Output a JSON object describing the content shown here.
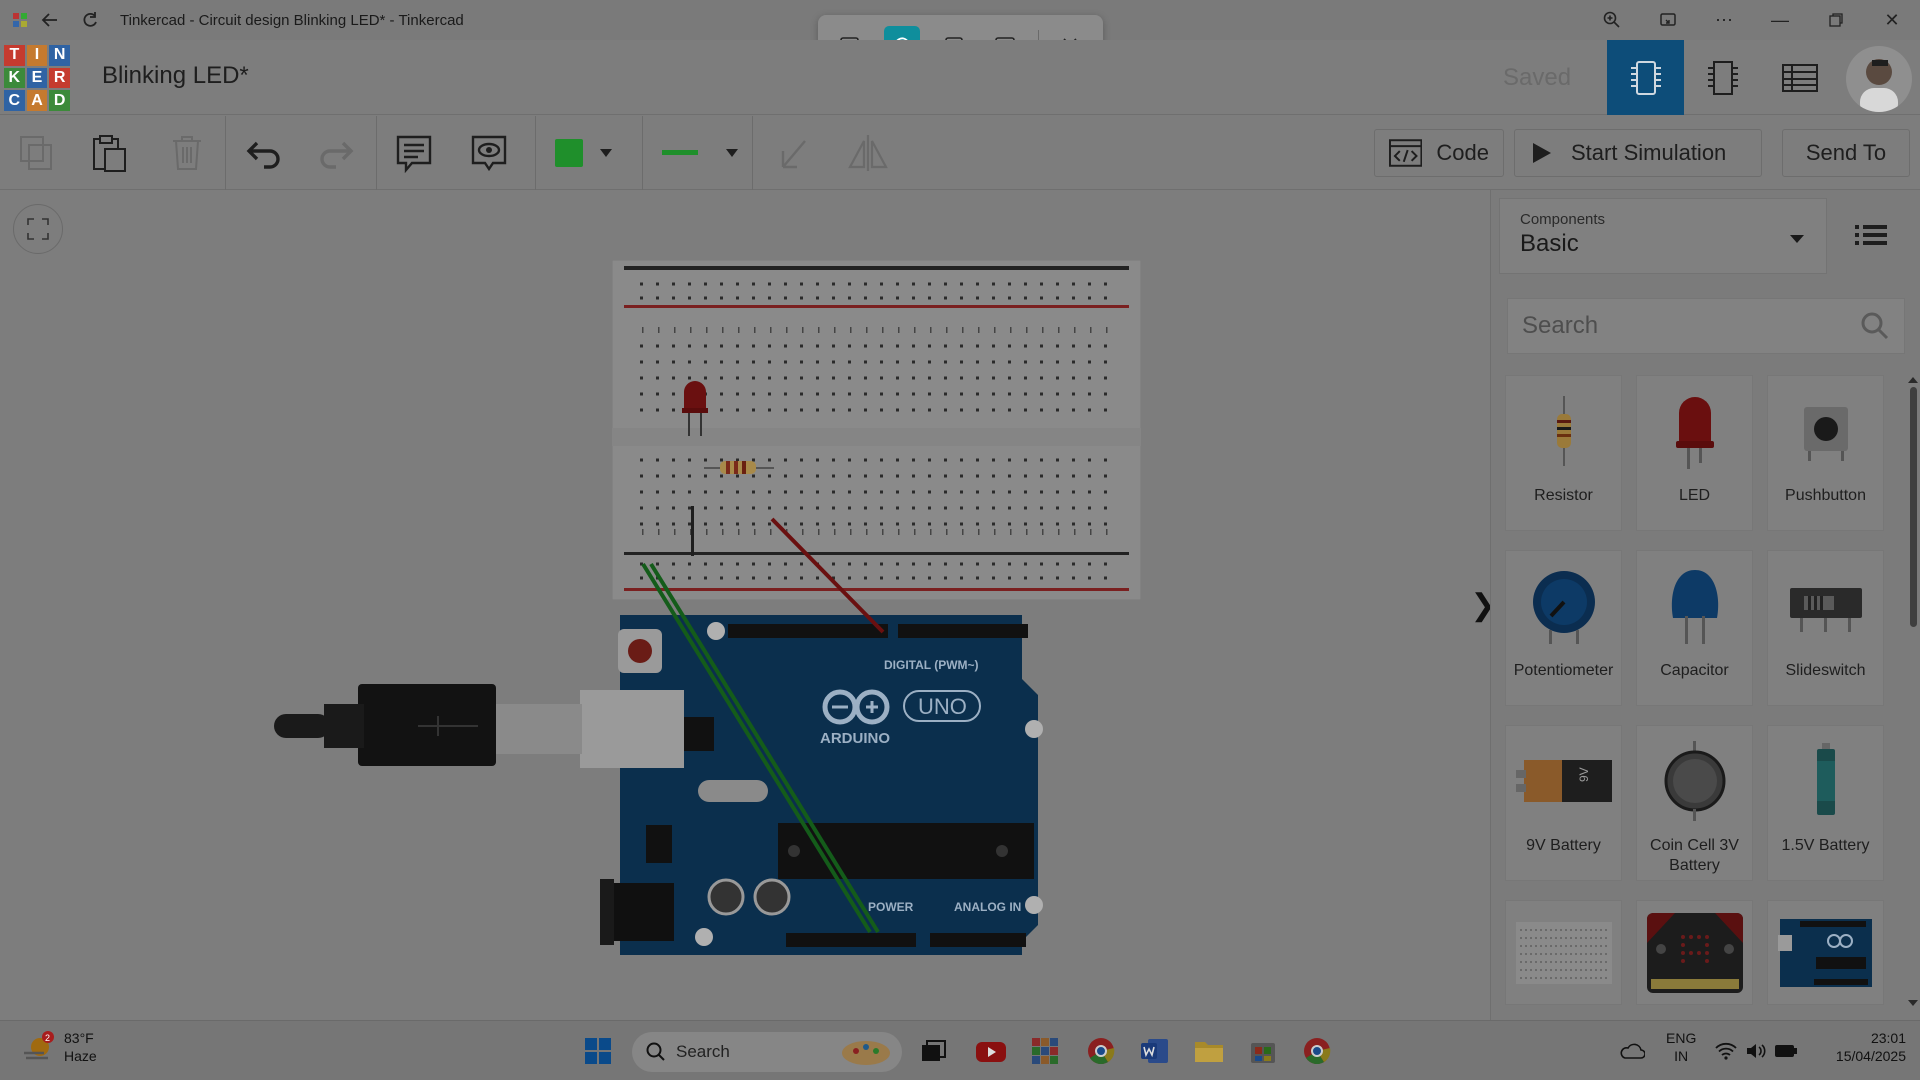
{
  "window": {
    "title": "Tinkercad - Circuit design Blinking LED* - Tinkercad"
  },
  "app": {
    "logo_letters": [
      "T",
      "I",
      "N",
      "K",
      "E",
      "R",
      "C",
      "A",
      "D"
    ],
    "project_title": "Blinking LED*",
    "saved_status": "Saved"
  },
  "toolbar": {
    "code_label": "Code",
    "start_sim_label": "Start Simulation",
    "send_to_label": "Send To",
    "wire_color": "#1f8f2b"
  },
  "panel": {
    "components_label": "Components",
    "components_value": "Basic",
    "search_placeholder": "Search",
    "items": [
      {
        "label": "Resistor"
      },
      {
        "label": "LED"
      },
      {
        "label": "Pushbutton"
      },
      {
        "label": "Potentiometer"
      },
      {
        "label": "Capacitor"
      },
      {
        "label": "Slideswitch"
      },
      {
        "label": "9V Battery"
      },
      {
        "label": "Coin Cell 3V Battery"
      },
      {
        "label": "1.5V Battery"
      }
    ]
  },
  "board": {
    "digital_label": "DIGITAL (PWM~)",
    "brand": "ARDUINO",
    "model": "UNO",
    "power_label": "POWER",
    "analog_label": "ANALOG IN",
    "battery_label": "9V"
  },
  "taskbar": {
    "weather_badge": "2",
    "temperature": "83°F",
    "condition": "Haze",
    "search_placeholder": "Search",
    "lang_1": "ENG",
    "lang_2": "IN",
    "time": "23:01",
    "date": "15/04/2025"
  }
}
